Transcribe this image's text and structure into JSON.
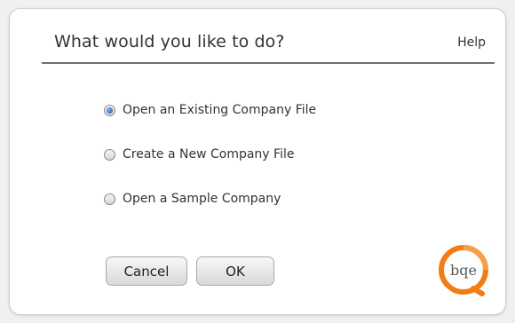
{
  "dialog": {
    "title": "What would you like to do?",
    "help_label": "Help",
    "options": [
      {
        "label": "Open an Existing Company File",
        "selected": true
      },
      {
        "label": "Create a New Company File",
        "selected": false
      },
      {
        "label": "Open a Sample Company",
        "selected": false
      }
    ],
    "buttons": {
      "cancel_label": "Cancel",
      "ok_label": "OK"
    },
    "logo": {
      "text": "bqe",
      "icon": "bqe-logo",
      "accent_color": "#f07d16"
    }
  }
}
